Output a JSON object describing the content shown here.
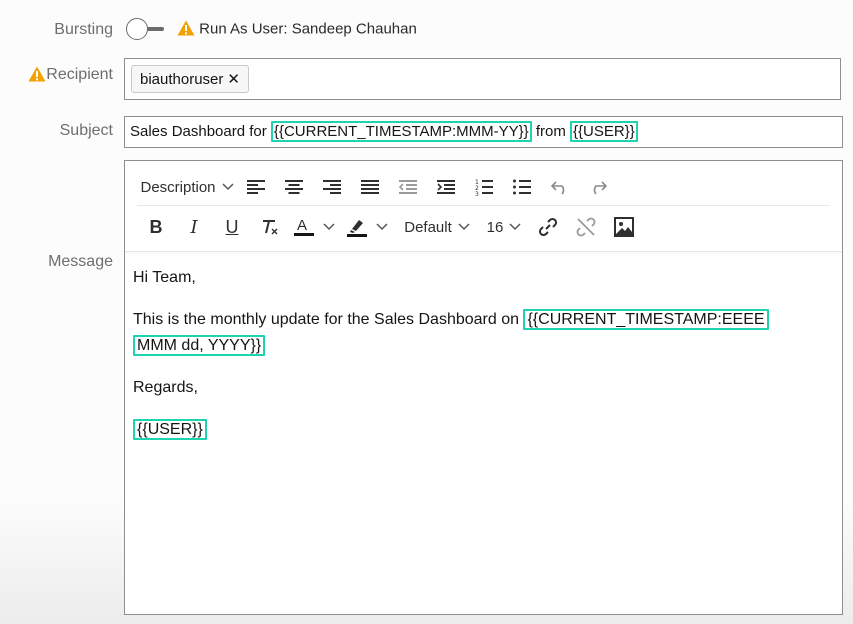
{
  "bursting": {
    "label": "Bursting",
    "enabled": false,
    "run_as": "Run As User: Sandeep Chauhan"
  },
  "recipient": {
    "label": "Recipient",
    "chips": [
      "biauthoruser"
    ]
  },
  "subject": {
    "label": "Subject",
    "part1": "Sales Dashboard for ",
    "token1": "{{CURRENT_TIMESTAMP:MMM-YY}}",
    "part2": " from ",
    "token2": "{{USER}}"
  },
  "message": {
    "label": "Message",
    "toolbar": {
      "format": "Description",
      "font": "Default",
      "size": "16"
    },
    "greeting": "Hi Team,",
    "body_text": "This is the monthly update for the Sales Dashboard on ",
    "body_token_line1": "{{CURRENT_TIMESTAMP:EEEE",
    "body_token_line2": "MMM dd, YYYY}}",
    "closing": "Regards,",
    "signature": "{{USER}}"
  },
  "colors": {
    "highlight": "#1ed3b0",
    "warning": "#f2a100"
  }
}
